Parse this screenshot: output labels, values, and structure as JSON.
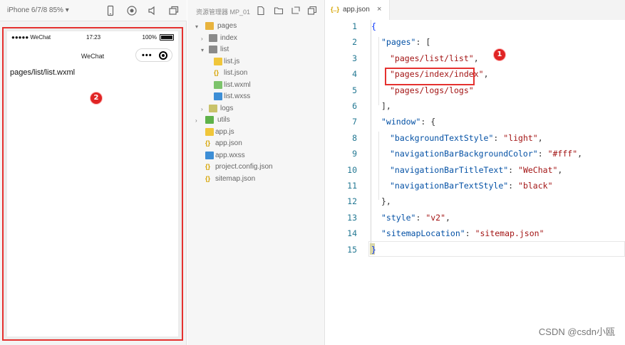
{
  "simulator": {
    "device_label": "iPhone 6/7/8 85% ▾",
    "status": {
      "carrier": "●●●●● WeChat ",
      "time": "17:23",
      "battery_text": "100%"
    },
    "nav_title": "WeChat",
    "capsule_dots": "•••",
    "page_text": "pages/list/list.wxml",
    "badge": "2"
  },
  "explorer": {
    "title": "资源管理器 MP_01",
    "items": [
      {
        "label": "pages",
        "icon": "folder-icon"
      },
      {
        "label": "index",
        "icon": "folder-icon"
      },
      {
        "label": "list",
        "icon": "folder-icon"
      },
      {
        "label": "list.js",
        "icon": "js-icon"
      },
      {
        "label": "list.json",
        "icon": "json-icon"
      },
      {
        "label": "list.wxml",
        "icon": "wxml-icon"
      },
      {
        "label": "list.wxss",
        "icon": "wxss-icon"
      },
      {
        "label": "logs",
        "icon": "folder-icon"
      },
      {
        "label": "utils",
        "icon": "folder-icon"
      },
      {
        "label": "app.js",
        "icon": "js-icon"
      },
      {
        "label": "app.json",
        "icon": "json-icon"
      },
      {
        "label": "app.wxss",
        "icon": "wxss-icon"
      },
      {
        "label": "project.config.json",
        "icon": "json-icon"
      },
      {
        "label": "sitemap.json",
        "icon": "json-icon"
      }
    ]
  },
  "editor": {
    "tab": {
      "icon_text": "{..}",
      "label": "app.json",
      "close": "×"
    },
    "line_numbers": [
      "1",
      "2",
      "3",
      "4",
      "5",
      "6",
      "7",
      "8",
      "9",
      "10",
      "11",
      "12",
      "13",
      "14",
      "15"
    ],
    "code": {
      "l1": "{",
      "l2_key": "\"pages\"",
      "l2_rest": ": [",
      "l3": "\"pages/list/list\"",
      "l3_comma": ",",
      "l4": "\"pages/index/index\"",
      "l4_comma": ",",
      "l5": "\"pages/logs/logs\"",
      "l6": "],",
      "l7_key": "\"window\"",
      "l7_rest": ": {",
      "l8_key": "\"backgroundTextStyle\"",
      "l8_val": "\"light\"",
      "l9_key": "\"navigationBarBackgroundColor\"",
      "l9_val": "\"#fff\"",
      "l10_key": "\"navigationBarTitleText\"",
      "l10_val": "\"WeChat\"",
      "l11_key": "\"navigationBarTextStyle\"",
      "l11_val": "\"black\"",
      "l12": "},",
      "l13_key": "\"style\"",
      "l13_val": "\"v2\"",
      "l14_key": "\"sitemapLocation\"",
      "l14_val": "\"sitemap.json\"",
      "l15": "}"
    },
    "badge": "1"
  },
  "watermark": "CSDN @csdn小瓯",
  "colors": {
    "annotation_red": "#e5312f",
    "badge_red": "#e02424",
    "folder_yellow": "#e8b33d",
    "folder_green": "#5fb24a"
  }
}
